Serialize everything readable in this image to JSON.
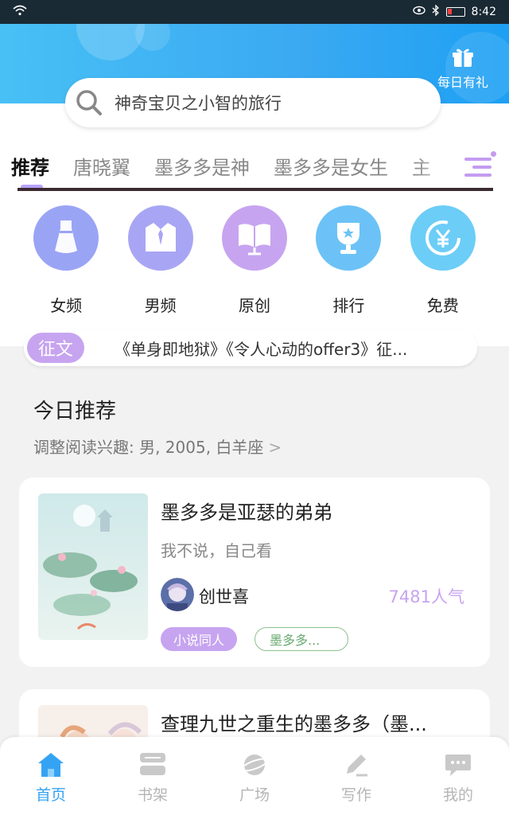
{
  "status_bar": {
    "time": "8:42"
  },
  "header": {
    "daily_gift_label": "每日有礼",
    "search_text": "神奇宝贝之小智的旅行"
  },
  "tabs": [
    "推荐",
    "唐晓翼",
    "墨多多是神",
    "墨多多是女生",
    "主"
  ],
  "categories": [
    {
      "label": "女频",
      "icon": "dress-icon",
      "color": "#9aa4f5"
    },
    {
      "label": "男频",
      "icon": "shirt-icon",
      "color": "#a8a6f4"
    },
    {
      "label": "原创",
      "icon": "book-icon",
      "color": "#c7a4f0"
    },
    {
      "label": "排行",
      "icon": "trophy-icon",
      "color": "#6cc2f6"
    },
    {
      "label": "免费",
      "icon": "yuan-icon",
      "color": "#6ccdf7"
    }
  ],
  "notice": {
    "badge": "征文",
    "text": "《单身即地狱》《令人心动的offer3》征..."
  },
  "section": {
    "title": "今日推荐",
    "subtitle": "调整阅读兴趣: 男, 2005, 白羊座"
  },
  "books": [
    {
      "title": "墨多多是亚瑟的弟弟",
      "desc": "我不说，自己看",
      "author": "创世喜",
      "popularity": "7481人气",
      "tag_category": "小说同人",
      "tag_topic": "墨多多..."
    },
    {
      "title": "查理九世之重生的墨多多（墨..."
    }
  ],
  "bottom_nav": [
    {
      "label": "首页",
      "icon": "home-icon",
      "active": true
    },
    {
      "label": "书架",
      "icon": "bookshelf-icon",
      "active": false
    },
    {
      "label": "广场",
      "icon": "planet-icon",
      "active": false
    },
    {
      "label": "写作",
      "icon": "pen-icon",
      "active": false
    },
    {
      "label": "我的",
      "icon": "chat-icon",
      "active": false
    }
  ]
}
